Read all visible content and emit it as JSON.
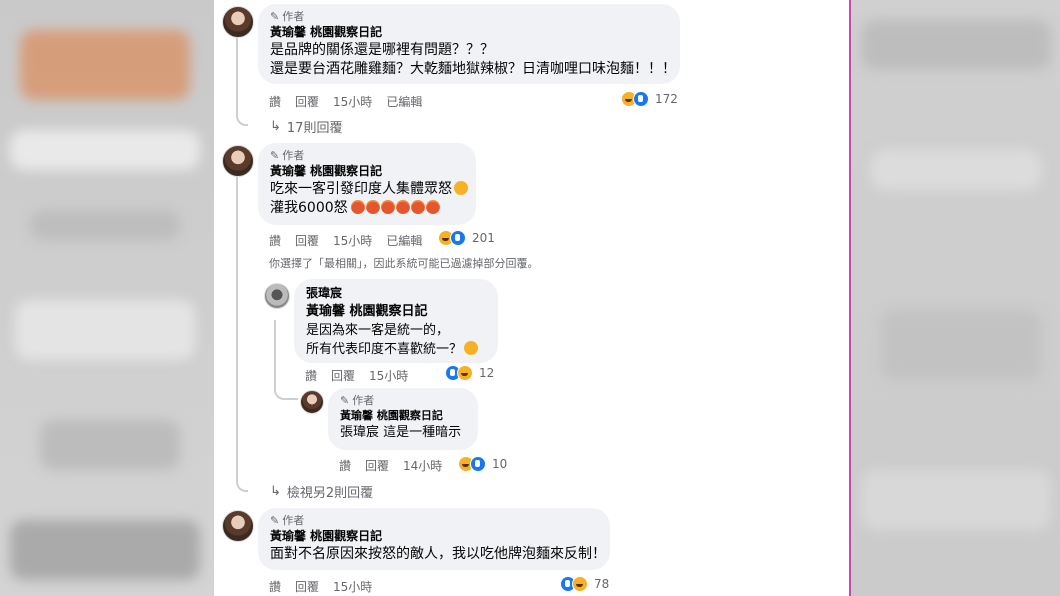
{
  "comments": [
    {
      "badge": "作者",
      "name": "黃瑜馨 桃園觀察日記",
      "lines": [
        "是品牌的關係還是哪裡有問題？？？",
        "還是要台酒花雕雞麵？大乾麵地獄辣椒？日清咖哩口味泡麵！！！"
      ],
      "actions": {
        "like": "讚",
        "reply": "回覆",
        "time": "15小時",
        "edited": "已編輯"
      },
      "reaction_count": "172",
      "more_replies": "17則回覆"
    },
    {
      "badge": "作者",
      "name": "黃瑜馨 桃園觀察日記",
      "lines": [
        "吃來一客引發印度人集體眾怒",
        "灌我6000怒"
      ],
      "actions": {
        "like": "讚",
        "reply": "回覆",
        "time": "15小時",
        "edited": "已編輯"
      },
      "reaction_count": "201"
    },
    {
      "name": "張瑋宸",
      "mention": "黃瑜馨 桃園觀察日記",
      "lines": [
        "是因為來一客是統一的，",
        "所有代表印度不喜歡統一？"
      ],
      "actions": {
        "like": "讚",
        "reply": "回覆",
        "time": "15小時"
      },
      "reaction_count": "12"
    },
    {
      "badge": "作者",
      "name": "黃瑜馨 桃園觀察日記",
      "lines": [
        "張瑋宸 這是一種暗示"
      ],
      "actions": {
        "like": "讚",
        "reply": "回覆",
        "time": "14小時"
      },
      "reaction_count": "10"
    },
    {
      "badge": "作者",
      "name": "黃瑜馨 桃園觀察日記",
      "lines": [
        "面對不名原因來按怒的敵人，我以吃他牌泡麵來反制！"
      ],
      "actions": {
        "like": "讚",
        "reply": "回覆",
        "time": "15小時"
      },
      "reaction_count": "78"
    }
  ],
  "notice": "你選擇了「最相關」，因此系統可能已過濾掉部分回覆。",
  "view_more": "檢視另2則回覆",
  "colors": {
    "bubble": "#f0f2f5",
    "meta": "#65676b",
    "accent_edge": "#c64aa8"
  }
}
